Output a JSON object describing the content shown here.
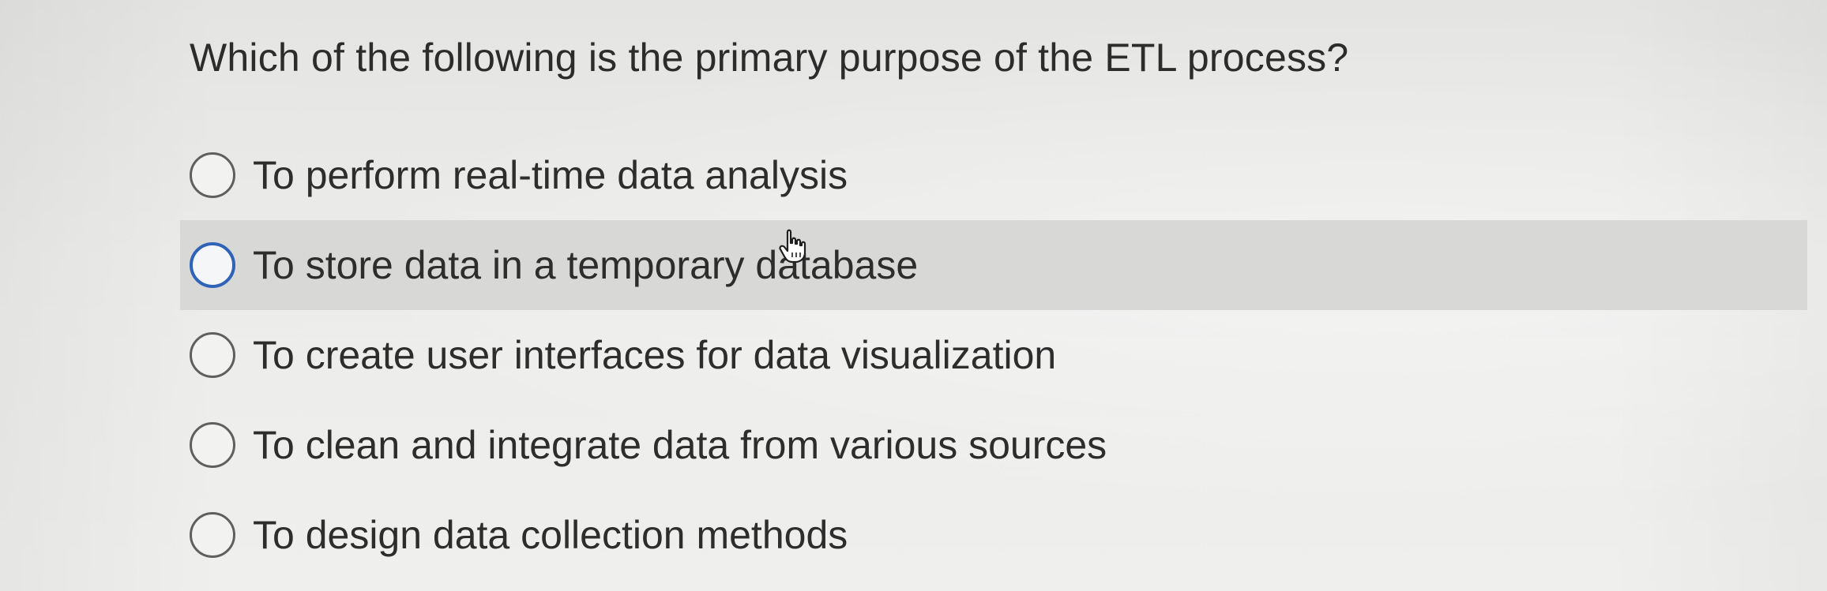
{
  "question": {
    "text": "Which of the following is the primary purpose of the ETL process?"
  },
  "options": [
    {
      "label": "To perform real-time data analysis",
      "highlighted": false
    },
    {
      "label": "To store data in a temporary database",
      "highlighted": true
    },
    {
      "label": "To create user interfaces for data visualization",
      "highlighted": false
    },
    {
      "label": "To clean and integrate data from various sources",
      "highlighted": false
    },
    {
      "label": "To design data collection methods",
      "highlighted": false
    }
  ],
  "colors": {
    "highlight_background": "#d8d8d6",
    "focused_radio_border": "#2f63b8",
    "radio_border": "#5f5f5f",
    "text": "#2d2d2d"
  },
  "icons": {
    "pointer": "hand-pointer-icon"
  }
}
